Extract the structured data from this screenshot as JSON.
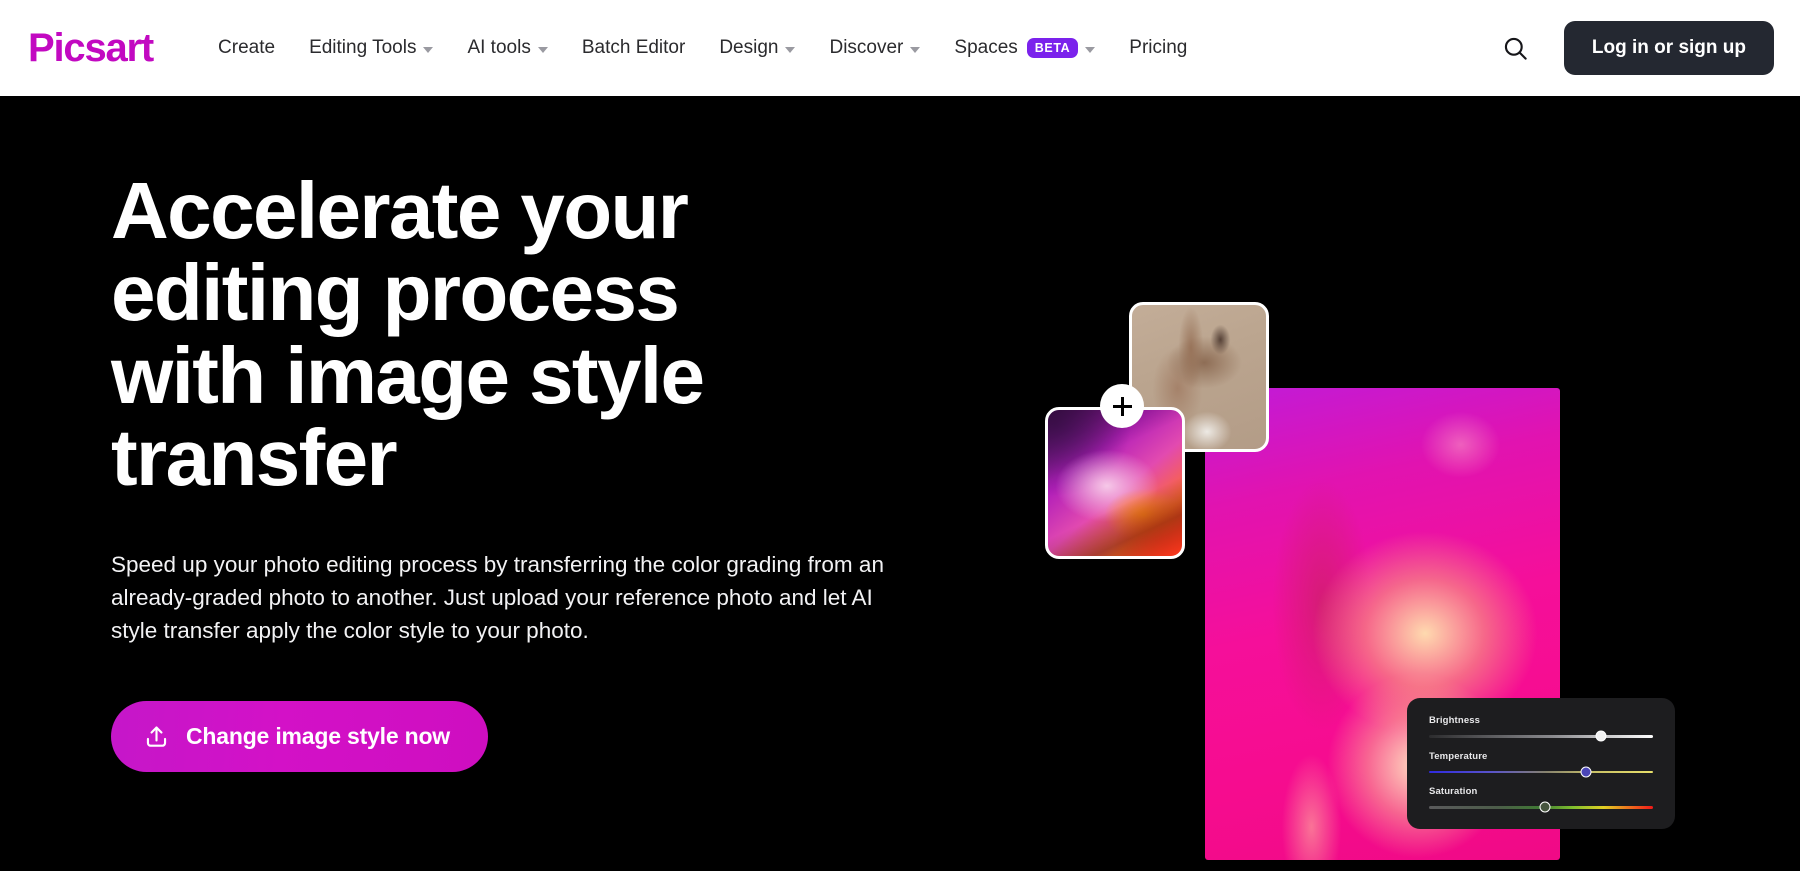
{
  "header": {
    "logo_text": "Picsart",
    "nav_items": [
      {
        "label": "Create",
        "has_caret": false,
        "badge": null
      },
      {
        "label": "Editing Tools",
        "has_caret": true,
        "badge": null
      },
      {
        "label": "AI tools",
        "has_caret": true,
        "badge": null
      },
      {
        "label": "Batch Editor",
        "has_caret": false,
        "badge": null
      },
      {
        "label": "Design",
        "has_caret": true,
        "badge": null
      },
      {
        "label": "Discover",
        "has_caret": true,
        "badge": null
      },
      {
        "label": "Spaces",
        "has_caret": true,
        "badge": "BETA"
      },
      {
        "label": "Pricing",
        "has_caret": false,
        "badge": null
      }
    ],
    "search_icon": "search-icon",
    "login_label": "Log in or sign up"
  },
  "hero": {
    "title": "Accelerate your editing process with image style transfer",
    "subtitle": "Speed up your photo editing process by transferring the color grading from an already-graded photo to another. Just upload your reference photo and let AI style transfer apply the color style to your photo.",
    "cta_label": "Change image style now",
    "cta_icon": "upload-icon",
    "plus_icon": "plus-icon"
  },
  "adjust_panel": {
    "sliders": [
      {
        "label": "Brightness",
        "value_pct": 77
      },
      {
        "label": "Temperature",
        "value_pct": 70
      },
      {
        "label": "Saturation",
        "value_pct": 52
      }
    ]
  },
  "colors": {
    "brand_magenta": "#C209C1",
    "beta_violet": "#7B22EC",
    "login_dark": "#242831",
    "hero_background": "#000000",
    "header_background": "#FFFFFF",
    "panel_background": "#1D1D1F"
  }
}
